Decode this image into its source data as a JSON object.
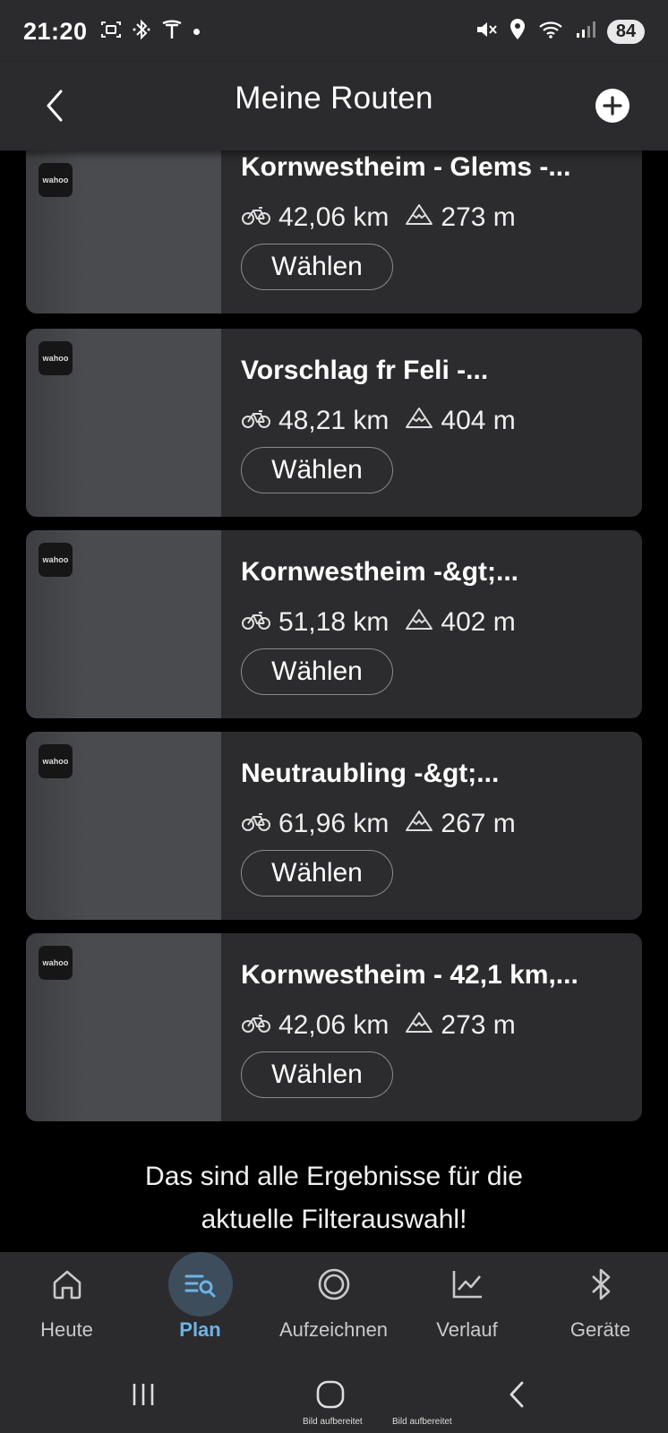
{
  "status_bar": {
    "time": "21:20",
    "battery": "84",
    "icons_left": [
      "screenshot-icon",
      "bluetooth-icon",
      "tesla-icon",
      "dot-icon"
    ],
    "icons_right": [
      "mute-icon",
      "location-icon",
      "wifi-icon",
      "signal-icon"
    ]
  },
  "header": {
    "title": "Meine Routen"
  },
  "routes": [
    {
      "name": "Kornwestheim - Glems -...",
      "distance": "42,06 km",
      "elevation": "273 m",
      "select_label": "Wählen",
      "logo_text": "wahoo"
    },
    {
      "name": "Vorschlag fr Feli -...",
      "distance": "48,21 km",
      "elevation": "404 m",
      "select_label": "Wählen",
      "logo_text": "wahoo"
    },
    {
      "name": "Kornwestheim -&gt;...",
      "distance": "51,18 km",
      "elevation": "402 m",
      "select_label": "Wählen",
      "logo_text": "wahoo"
    },
    {
      "name": "Neutraubling -&gt;...",
      "distance": "61,96 km",
      "elevation": "267 m",
      "select_label": "Wählen",
      "logo_text": "wahoo"
    },
    {
      "name": "Kornwestheim - 42,1 km,...",
      "distance": "42,06 km",
      "elevation": "273 m",
      "select_label": "Wählen",
      "logo_text": "wahoo"
    }
  ],
  "end_message": {
    "line1": "Das sind alle Ergebnisse für die",
    "line2": "aktuelle Filterauswahl!"
  },
  "bottom_nav": {
    "items": [
      {
        "label": "Heute",
        "icon": "home-icon",
        "active": false
      },
      {
        "label": "Plan",
        "icon": "plan-search-icon",
        "active": true
      },
      {
        "label": "Aufzeichnen",
        "icon": "record-icon",
        "active": false
      },
      {
        "label": "Verlauf",
        "icon": "chart-trend-icon",
        "active": false
      },
      {
        "label": "Geräte",
        "icon": "bluetooth-icon",
        "active": false
      }
    ]
  },
  "system_nav": {
    "caption_1": "Bild aufbereitet",
    "caption_2": "Bild aufbereitet"
  },
  "colors": {
    "bar_background": "#2b2b2d",
    "card_background": "#2c2c2e",
    "active_accent": "#6db3e8",
    "active_pill": "#3d4d5c"
  }
}
